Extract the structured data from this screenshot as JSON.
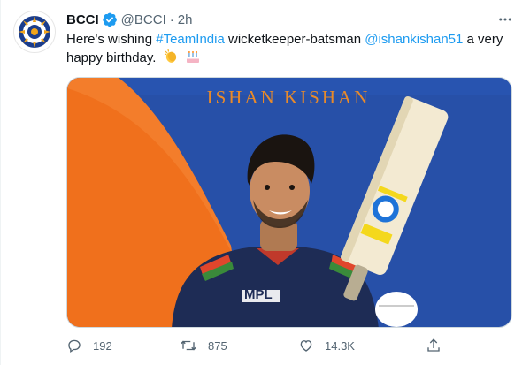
{
  "tweet": {
    "author_name": "BCCI",
    "handle": "@BCCI",
    "separator": "·",
    "time": "2h",
    "text_before": "Here's wishing ",
    "hashtag": "#TeamIndia",
    "text_middle": " wicketkeeper-batsman ",
    "mention": "@ishankishan51",
    "text_after": " a very happy birthday.",
    "emojis": [
      "clapping-hands",
      "birthday-cake"
    ]
  },
  "media": {
    "caption": "ISHAN KISHAN",
    "jersey_text": "MPL"
  },
  "actions": {
    "replies": "192",
    "retweets": "875",
    "likes": "14.3K"
  },
  "colors": {
    "link": "#1d9bf0",
    "muted": "#536471",
    "media_background": "#2750a8",
    "media_orange": "#f0701c"
  }
}
